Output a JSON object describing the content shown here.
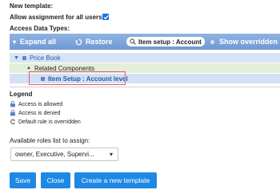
{
  "header": {
    "title": "New template:",
    "allow_label": "Allow assignment for all users:",
    "access_types_label": "Access Data Types:"
  },
  "toolbar": {
    "expand_label": "Expand all",
    "restore_label": "Restore",
    "search_value": "Item setup : Account",
    "show_overridden_label": "Show overridden"
  },
  "tree": {
    "row1_label": "Price Book",
    "row2_label": "Related Components",
    "row3_label": "Item Setup : Account level"
  },
  "legend": {
    "title": "Legend",
    "items": [
      "Access is allowed",
      "Access is denied",
      "Default rule is overridden"
    ]
  },
  "roles": {
    "label": "Available roles list to assign:",
    "selected": "owner, Executive, Supervi..."
  },
  "buttons": {
    "save": "Save",
    "close": "Close",
    "create": "Create a new template"
  },
  "colors": {
    "toolbar": "#7aa2d9",
    "button": "#1e88e5",
    "highlight_border": "#e05a6a"
  }
}
